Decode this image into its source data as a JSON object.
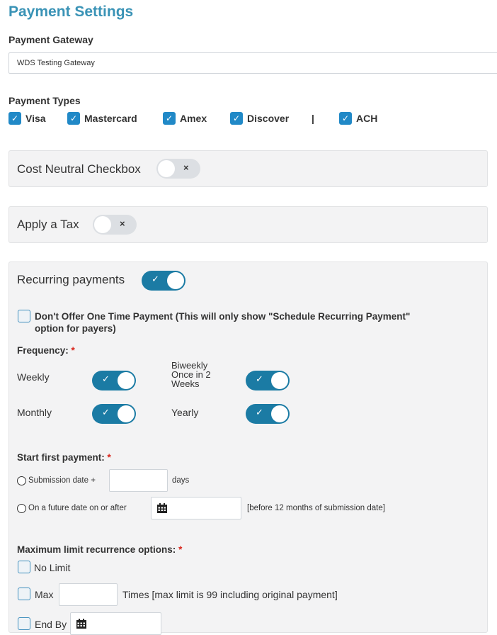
{
  "page": {
    "title": "Payment Settings"
  },
  "gateway": {
    "label": "Payment Gateway",
    "selected": "WDS Testing Gateway"
  },
  "payment_types": {
    "label": "Payment Types",
    "items": [
      "Visa",
      "Mastercard",
      "Amex",
      "Discover",
      "ACH"
    ],
    "separator": "|"
  },
  "cost_neutral": {
    "label": "Cost Neutral Checkbox",
    "state": "off"
  },
  "apply_tax": {
    "label": "Apply a Tax",
    "state": "off"
  },
  "recurring": {
    "label": "Recurring payments",
    "state": "on",
    "dont_offer_label": "Don't Offer One Time Payment (This will only show \"Schedule Recurring Payment\"",
    "dont_offer_label_2": "option for payers)",
    "frequency_label": "Frequency:",
    "required_mark": "*",
    "weekly": "Weekly",
    "biweekly_1": "Biweekly",
    "biweekly_2": "Once in 2",
    "biweekly_3": "Weeks",
    "monthly": "Monthly",
    "yearly": "Yearly",
    "start_label": "Start first payment:",
    "submission_date": "Submission date +",
    "days": "days",
    "future_date": "On a future date on or after",
    "before_note": "[before 12 months of submission date]",
    "max_limit_label": "Maximum limit recurrence options:",
    "no_limit": "No Limit",
    "max": "Max",
    "times_note": "Times [max limit is 99 including original payment]",
    "end_by": "End By"
  },
  "icons": {
    "check": "✓",
    "cross": "×",
    "chevron": "⌄",
    "calendar": "calendar-icon"
  },
  "colors": {
    "accent": "#3a93b6",
    "toggle_on": "#1b7ba4",
    "checkbox": "#2189c7",
    "required": "#d9261c"
  }
}
